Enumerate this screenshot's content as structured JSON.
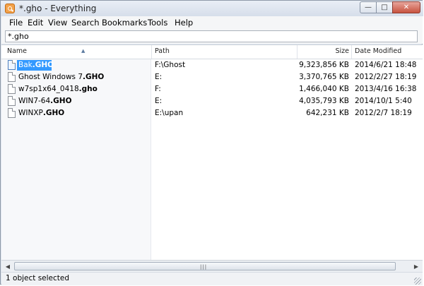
{
  "window": {
    "title": "*.gho - Everything",
    "buttons": {
      "minimize": "—",
      "maximize": "□",
      "close": "✕"
    }
  },
  "menu": [
    "File",
    "Edit",
    "View",
    "Search",
    "Bookmarks",
    "Tools",
    "Help"
  ],
  "search": {
    "value": "*.gho",
    "placeholder": ""
  },
  "columns": {
    "name": "Name",
    "path": "Path",
    "size": "Size",
    "date": "Date Modified"
  },
  "files": [
    {
      "name_pre": "Bak",
      "name_bold": ".GHO",
      "path": "F:\\Ghost",
      "size": "9,323,856 KB",
      "date": "2014/6/21 18:48",
      "selected": true
    },
    {
      "name_pre": "Ghost Windows 7",
      "name_bold": ".GHO",
      "path": "E:",
      "size": "3,370,765 KB",
      "date": "2012/2/27 18:19",
      "selected": false
    },
    {
      "name_pre": "w7sp1x64_0418",
      "name_bold": ".gho",
      "path": "F:",
      "size": "1,466,040 KB",
      "date": "2013/4/16 16:38",
      "selected": false
    },
    {
      "name_pre": "WIN7-64",
      "name_bold": ".GHO",
      "path": "E:",
      "size": "4,035,793 KB",
      "date": "2014/10/1 5:40",
      "selected": false
    },
    {
      "name_pre": "WINXP",
      "name_bold": ".GHO",
      "path": "E:\\upan",
      "size": "642,231 KB",
      "date": "2012/2/7 18:19",
      "selected": false
    }
  ],
  "status": {
    "text": "1 object selected"
  },
  "icons": [
    "app-icon",
    "file-icon",
    "sort-ascending-icon",
    "scroll-left-icon",
    "scroll-right-icon",
    "resize-grip-icon"
  ],
  "colors": {
    "selection": "#3399ff",
    "titlebar": "#dde4ee",
    "close_button": "#c8533f"
  }
}
